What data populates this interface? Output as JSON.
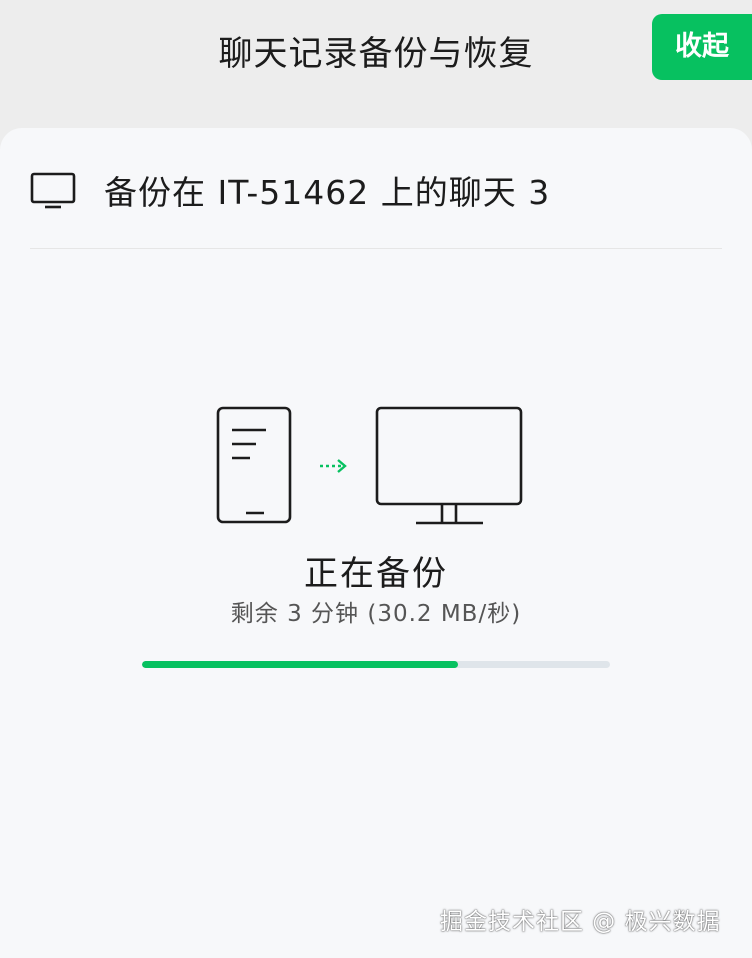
{
  "header": {
    "title": "聊天记录备份与恢复",
    "collapse_label": "收起"
  },
  "device": {
    "icon": "monitor-icon",
    "label": "备份在 IT-51462 上的聊天 3"
  },
  "backup": {
    "illustration_icons": [
      "phone-icon",
      "arrow-right-icon",
      "monitor-icon"
    ],
    "status_title": "正在备份",
    "status_detail": "剩余 3 分钟 (30.2 MB/秒)",
    "progress_fraction": 0.675
  },
  "watermark": "掘金技术社区 @ 极兴数据",
  "colors": {
    "accent": "#07c160",
    "track": "#dfe5ea",
    "background": "#ededed",
    "panel": "#f7f8fa"
  }
}
